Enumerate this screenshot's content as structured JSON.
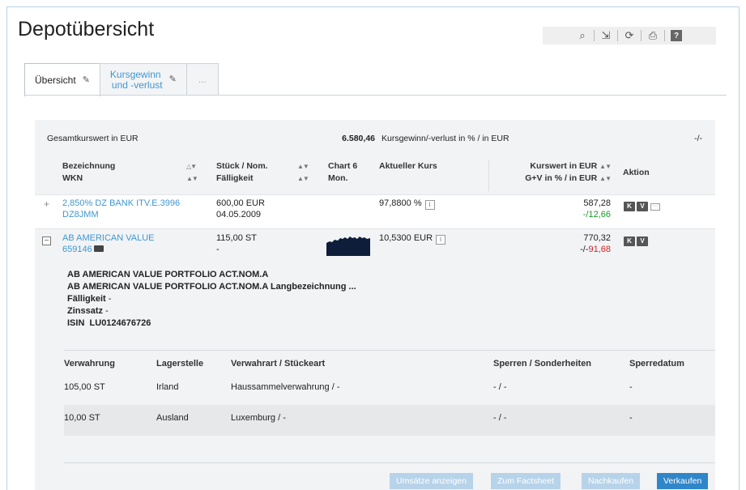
{
  "page": {
    "title": "Depotübersicht"
  },
  "toolbar": {
    "icons": [
      "binoculars-icon",
      "export-icon",
      "refresh-icon",
      "print-icon",
      "help-icon"
    ],
    "glyphs": [
      "⌕",
      "⇲",
      "⟳",
      "⎙",
      "?"
    ]
  },
  "tabs": [
    {
      "label": "Übersicht",
      "active": true
    },
    {
      "label_line1": "Kursgewinn",
      "label_line2": "und -verlust",
      "active": false
    },
    {
      "label": "...",
      "active": false
    }
  ],
  "summary": {
    "label": "Gesamtkurswert in EUR",
    "value": "6.580,46",
    "label2": "Kursgewinn/-verlust in % / in EUR",
    "arrow": "-/-"
  },
  "columns": {
    "bezeichnung": "Bezeichnung",
    "wkn": "WKN",
    "stueck": "Stück / Nom.",
    "faelligkeit": "Fälligkeit",
    "chart1": "Chart 6",
    "chart2": "Mon.",
    "kurs": "Aktueller Kurs",
    "kurswert": "Kurswert in EUR",
    "gv": "G+V in % / in EUR",
    "aktion": "Aktion",
    "sort": "▲▼",
    "sort_alt": "△▼"
  },
  "rows": [
    {
      "name": "2,850% DZ BANK ITV.E.3996",
      "wkn": "DZ8JMM",
      "stueck": "600,00 EUR",
      "faelligkeit": "04.05.2009",
      "kurs": "97,8800 %",
      "kurswert": "587,28",
      "gv": "-/12,66",
      "expand": "+",
      "actions": [
        "K",
        "V"
      ]
    },
    {
      "name": "AB AMERICAN VALUE",
      "wkn": "659146",
      "stueck": "115,00 ST",
      "faelligkeit": "-",
      "kurs": "10,5300 EUR",
      "kurswert": "770,32",
      "gv_prefix": "-/-",
      "gv_value": "91,68",
      "expand": "−",
      "actions": [
        "K",
        "V"
      ]
    }
  ],
  "detail": {
    "line1": "AB AMERICAN VALUE PORTFOLIO ACT.NOM.A",
    "line2": "AB AMERICAN VALUE PORTFOLIO ACT.NOM.A Langbezeichnung ...",
    "faelligkeit_label": "Fälligkeit",
    "faelligkeit_value": "-",
    "zinssatz_label": "Zinssatz",
    "zinssatz_value": "-",
    "isin_label": "ISIN",
    "isin_value": "LU0124676726"
  },
  "subtable": {
    "headers": [
      "Verwahrung",
      "Lagerstelle",
      "Verwahrart / Stückeart",
      "Sperren / Sonderheiten",
      "Sperredatum"
    ],
    "rows": [
      [
        "105,00 ST",
        "Irland",
        "Haussammelverwahrung / -",
        "- / -",
        "-"
      ],
      [
        "10,00 ST",
        "Ausland",
        "Luxemburg / -",
        "- / -",
        "-"
      ]
    ]
  },
  "buttons": {
    "umsaetze": "Umsätze anzeigen",
    "factsheet": "Zum Factsheet",
    "nachkaufen": "Nachkaufen",
    "verkaufen": "Verkaufen"
  },
  "colors": {
    "link": "#3f97d2",
    "positive": "#1a9a2a",
    "negative": "#d12323",
    "primary_button": "#2f86c8",
    "disabled_button": "#b7d3ea"
  }
}
